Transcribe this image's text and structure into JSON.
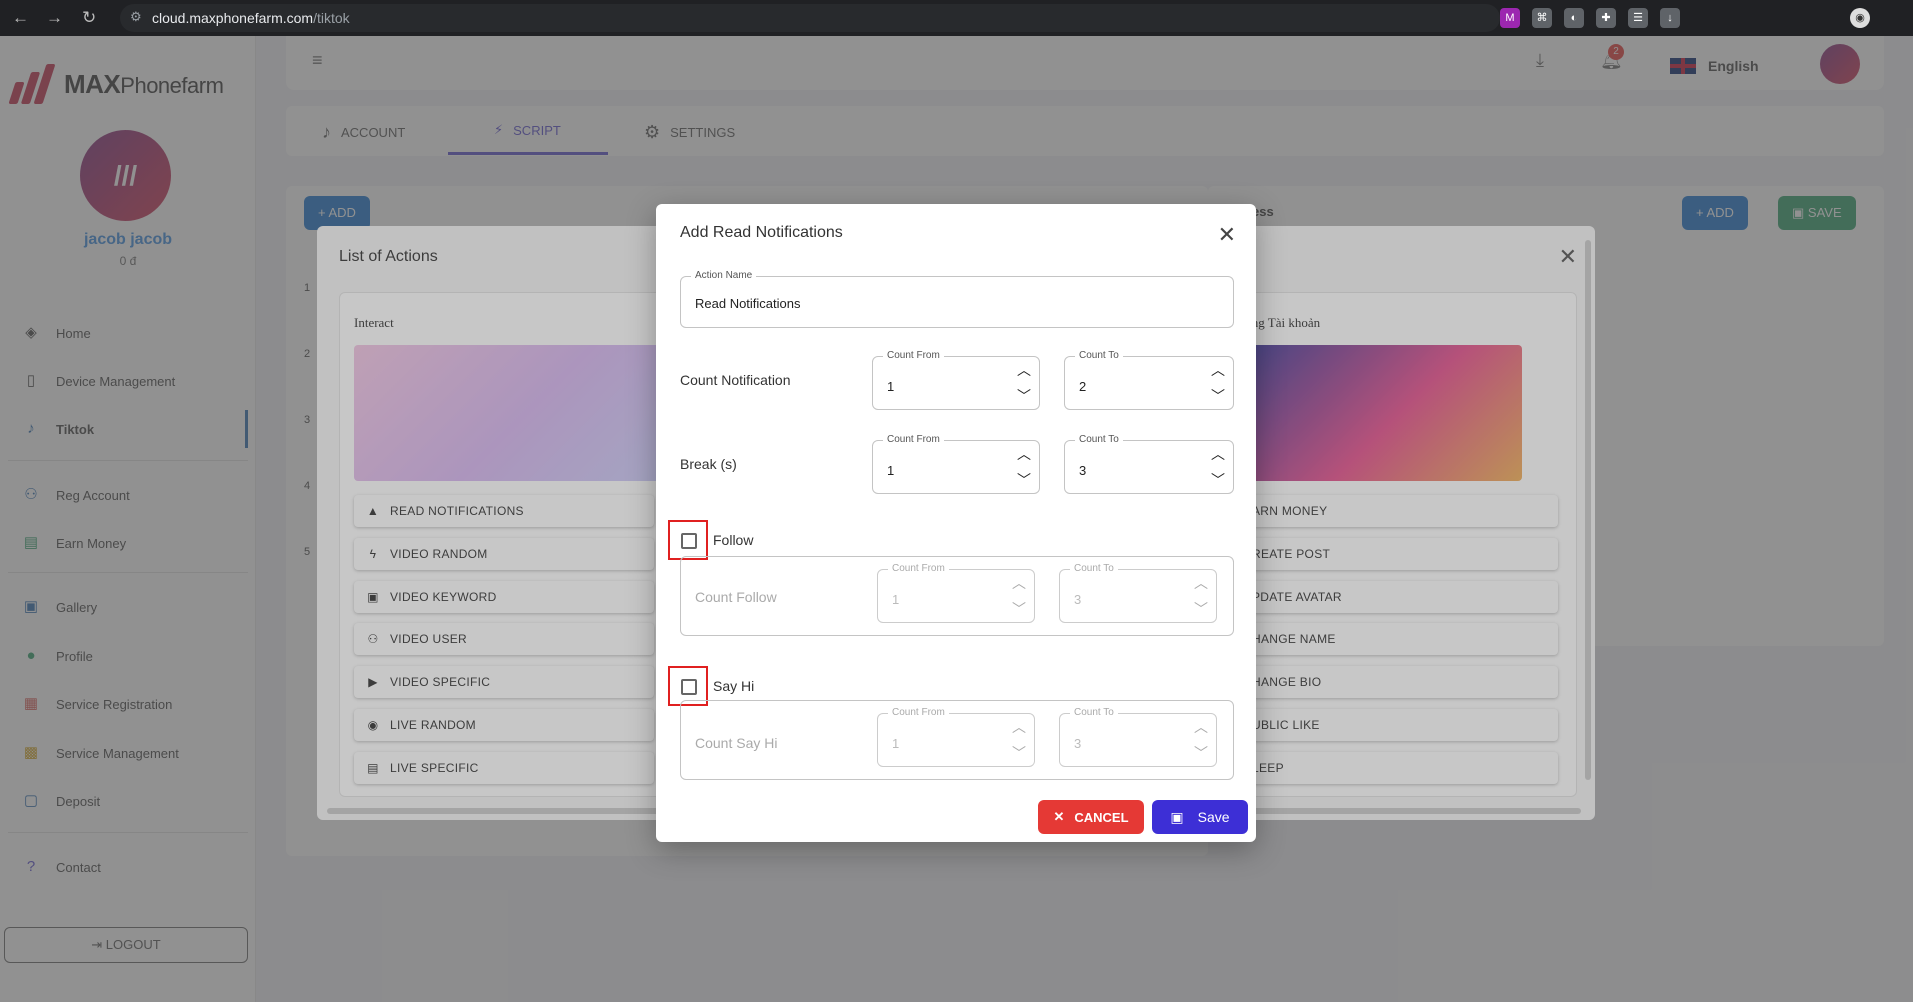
{
  "browser": {
    "url_host": "cloud.maxphonefarm.com",
    "url_path": "/tiktok"
  },
  "brand": {
    "name_bold": "MAX",
    "name_rest": "Phonefarm"
  },
  "user": {
    "name": "jacob jacob",
    "credit": "0 đ"
  },
  "sidebar": {
    "items": [
      {
        "label": "Home",
        "icon": "layers-icon"
      },
      {
        "label": "Device Management",
        "icon": "device-icon"
      },
      {
        "label": "Tiktok",
        "icon": "tiktok-icon"
      },
      {
        "label": "Reg Account",
        "icon": "users-icon"
      },
      {
        "label": "Earn Money",
        "icon": "money-icon"
      },
      {
        "label": "Gallery",
        "icon": "image-icon"
      },
      {
        "label": "Profile",
        "icon": "person-icon"
      },
      {
        "label": "Service Registration",
        "icon": "grid-icon"
      },
      {
        "label": "Service Management",
        "icon": "manage-icon"
      },
      {
        "label": "Deposit",
        "icon": "wallet-icon"
      },
      {
        "label": "Contact",
        "icon": "help-icon"
      }
    ],
    "logout": "LOGOUT"
  },
  "topbar": {
    "language": "English",
    "notification_count": "2"
  },
  "tabs": [
    "ACCOUNT",
    "SCRIPT",
    "SETTINGS"
  ],
  "page": {
    "add_label": "ADD",
    "save_label": "SAVE",
    "right_heading_fragment": "ess",
    "row_numbers": [
      "1",
      "2",
      "3",
      "4",
      "5"
    ]
  },
  "list_modal": {
    "title": "List of Actions",
    "left_panel_title": "Interact",
    "right_panel_title": "ăng Tài khoản",
    "left_actions": [
      "READ NOTIFICATIONS",
      "VIDEO RANDOM",
      "VIDEO KEYWORD",
      "VIDEO USER",
      "VIDEO SPECIFIC",
      "LIVE RANDOM",
      "LIVE SPECIFIC"
    ],
    "right_actions": [
      "ARN MONEY",
      "REATE POST",
      "PDATE AVATAR",
      "HANGE NAME",
      "HANGE BIO",
      "UBLIC LIKE",
      "LEEP"
    ]
  },
  "dialog": {
    "title": "Add Read Notifications",
    "action_name_label": "Action Name",
    "action_name_value": "Read Notifications",
    "count_notification": {
      "label": "Count Notification",
      "from_label": "Count From",
      "from": "1",
      "to_label": "Count To",
      "to": "2"
    },
    "break": {
      "label": "Break (s)",
      "from_label": "Count From",
      "from": "1",
      "to_label": "Count To",
      "to": "3"
    },
    "follow": {
      "checkbox_label": "Follow",
      "checked": false,
      "group_label": "Count Follow",
      "from_label": "Count From",
      "from": "1",
      "to_label": "Count To",
      "to": "3"
    },
    "say_hi": {
      "checkbox_label": "Say Hi",
      "checked": false,
      "group_label": "Count Say Hi",
      "from_label": "Count From",
      "from": "1",
      "to_label": "Count To",
      "to": "3"
    },
    "cancel_label": "CANCEL",
    "save_label": "Save"
  },
  "colors": {
    "accent": "#5a4fcf",
    "cancel": "#e53935",
    "save": "#3d2fd6",
    "highlight": "#e02020"
  }
}
